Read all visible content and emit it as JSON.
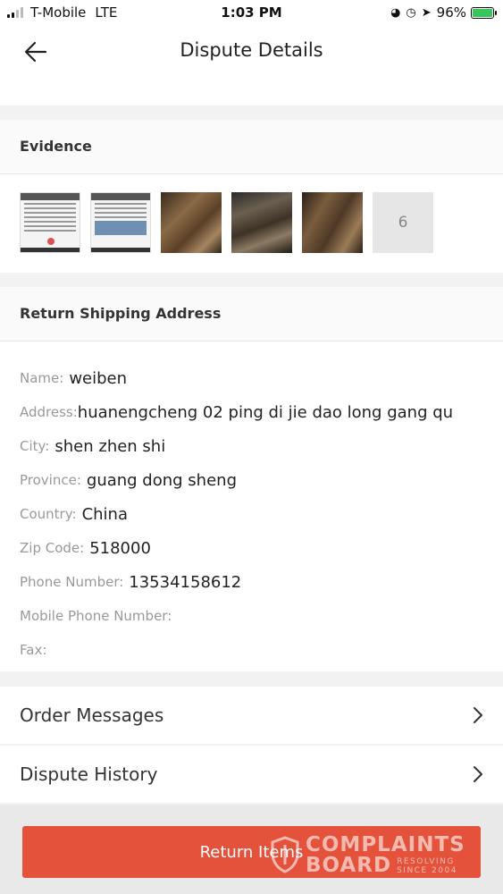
{
  "status_bar": {
    "carrier": "T-Mobile",
    "network": "LTE",
    "time": "1:03 PM",
    "battery": "96%"
  },
  "header": {
    "title": "Dispute Details"
  },
  "evidence": {
    "title": "Evidence",
    "thumbnails": [
      "doc-screenshot",
      "doc-screenshot",
      "photo",
      "photo",
      "photo"
    ],
    "more_count": "6"
  },
  "shipping": {
    "title": "Return Shipping Address",
    "fields": [
      {
        "label": "Name:",
        "value": "weiben"
      },
      {
        "label": "Address:",
        "value": "huanengcheng 02 ping di jie dao long gang qu"
      },
      {
        "label": "City:",
        "value": "shen zhen shi"
      },
      {
        "label": "Province:",
        "value": "guang dong sheng"
      },
      {
        "label": "Country:",
        "value": "China"
      },
      {
        "label": "Zip Code:",
        "value": "518000"
      },
      {
        "label": "Phone Number:",
        "value": "13534158612"
      },
      {
        "label": "Mobile Phone Number:",
        "value": ""
      },
      {
        "label": "Fax:",
        "value": ""
      }
    ]
  },
  "nav": {
    "order_messages": "Order Messages",
    "dispute_history": "Dispute History"
  },
  "footer": {
    "return_items": "Return Items"
  },
  "watermark": {
    "line1": "COMPLAINTS",
    "line2": "BOARD",
    "tag1": "RESOLVING",
    "tag2": "SINCE 2004"
  },
  "colors": {
    "accent": "#e4523b",
    "battery": "#35c759"
  }
}
